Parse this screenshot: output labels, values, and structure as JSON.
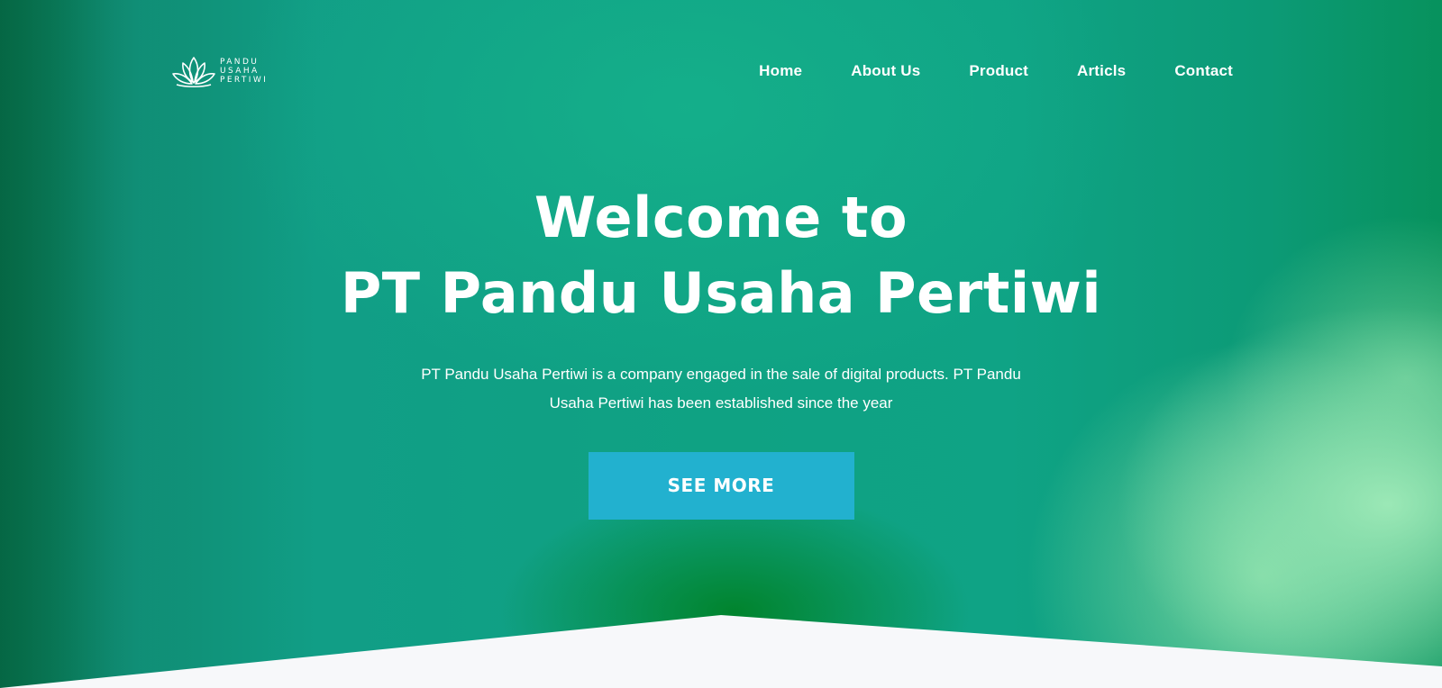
{
  "brand": {
    "logo_icon": "lotus-icon",
    "line1": "PANDU",
    "line2": "USAHA",
    "line3": "PERTIWI"
  },
  "nav": {
    "items": [
      {
        "label": "Home"
      },
      {
        "label": "About Us"
      },
      {
        "label": "Product"
      },
      {
        "label": "Articls"
      },
      {
        "label": "Contact"
      }
    ]
  },
  "hero": {
    "title_line1": "Welcome to",
    "title_line2": "PT Pandu Usaha Pertiwi",
    "description": "PT Pandu Usaha Pertiwi is a company engaged in the sale of digital products. PT Pandu Usaha Pertiwi has been established since the year",
    "cta_label": "SEE MORE"
  },
  "colors": {
    "accent": "#22b1cf",
    "primary_green": "#0fa283",
    "section_bg": "#f7f8fa"
  }
}
